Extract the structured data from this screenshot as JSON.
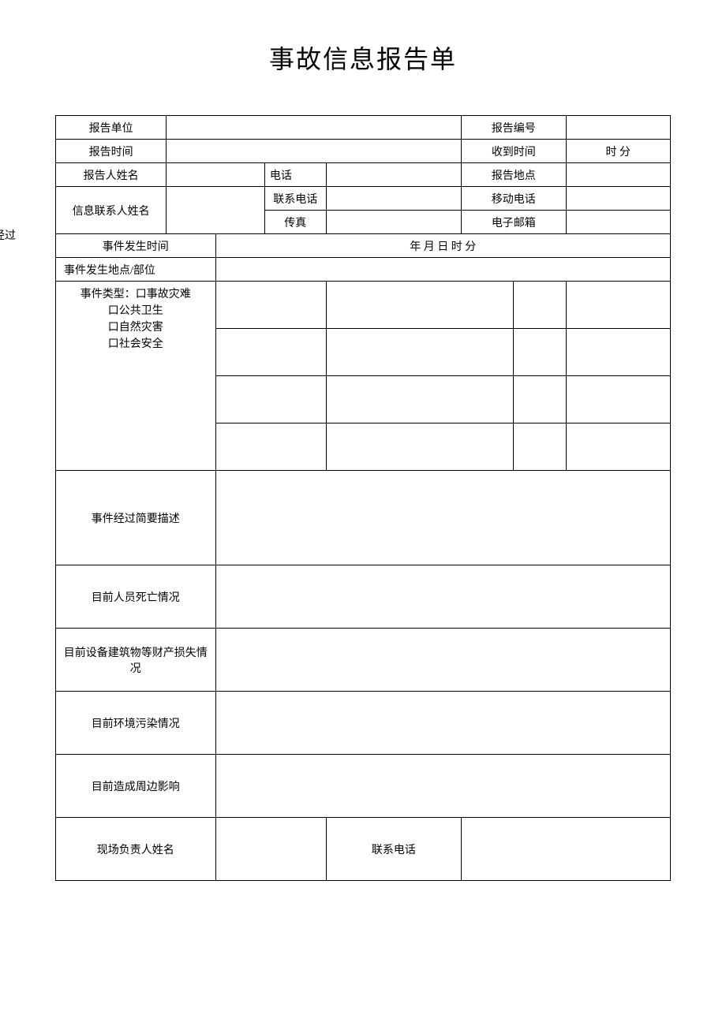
{
  "title": "事故信息报告单",
  "header": {
    "report_unit": "报告单位",
    "report_number": "报告编号",
    "report_time": "报告时间",
    "receive_time": "收到时间",
    "receive_time_value": "时 分",
    "reporter_name": "报告人姓名",
    "phone": "电话",
    "report_location": "报告地点",
    "contact_name": "信息联系人姓名",
    "contact_phone": "联系电话",
    "mobile": "移动电话",
    "fax": "传真",
    "email": "电子邮箱"
  },
  "overlay": "事件简要经过",
  "event": {
    "time_label": "事件发生时间",
    "time_value": "年  月  日  时  分",
    "location_label": "事件发生地点/部位",
    "type_label": "事件类型：口事故灾难\n口公共卫生\n口自然灾害\n口社会安全",
    "description_label": "事件经过简要描述",
    "casualty_label": "目前人员死亡情况",
    "property_loss_label": "目前设备建筑物等财产损失情况",
    "pollution_label": "目前环境污染情况",
    "surrounding_label": "目前造成周边影响",
    "site_manager_label": "现场负责人姓名",
    "contact_phone_label": "联系电话"
  }
}
